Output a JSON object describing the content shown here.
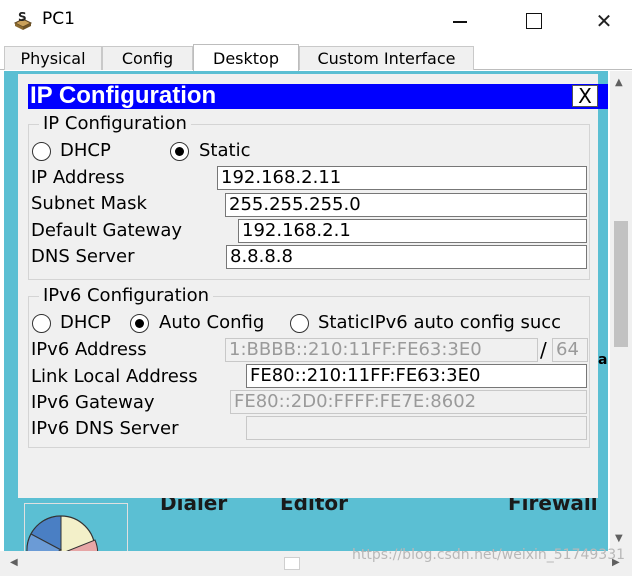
{
  "window": {
    "title": "PC1"
  },
  "tabs": [
    "Physical",
    "Config",
    "Desktop",
    "Custom Interface"
  ],
  "active_tab": "Desktop",
  "dialog": {
    "title": "IP Configuration",
    "close_label": "X",
    "ipv4": {
      "legend": "IP Configuration",
      "dhcp_label": "DHCP",
      "static_label": "Static",
      "selected": "Static",
      "ip_address_label": "IP Address",
      "ip_address": "192.168.2.11",
      "subnet_mask_label": "Subnet Mask",
      "subnet_mask": "255.255.255.0",
      "default_gateway_label": "Default Gateway",
      "default_gateway": "192.168.2.1",
      "dns_server_label": "DNS Server",
      "dns_server": "8.8.8.8"
    },
    "ipv6": {
      "legend": "IPv6 Configuration",
      "dhcp_label": "DHCP",
      "auto_label": "Auto Config",
      "static_label": "StaticIPv6 auto config succ",
      "selected": "Auto Config",
      "address_label": "IPv6 Address",
      "address": "1:BBBB::210:11FF:FE63:3E0",
      "prefix_separator": "/",
      "prefix": "64",
      "link_local_label": "Link Local Address",
      "link_local": "FE80::210:11FF:FE63:3E0",
      "gateway_label": "IPv6 Gateway",
      "gateway": "FE80::2D0:FFFF:FE7E:8602",
      "dns_label": "IPv6 DNS Server",
      "dns": ""
    }
  },
  "desktop": {
    "labels": [
      "Dialer",
      "Editor",
      "Firewall"
    ]
  },
  "watermark": "https://blog.csdn.net/weixin_51749331",
  "colors": {
    "dialog_title_bg": "#0000ff",
    "desktop_bg": "#5bbfd3"
  }
}
